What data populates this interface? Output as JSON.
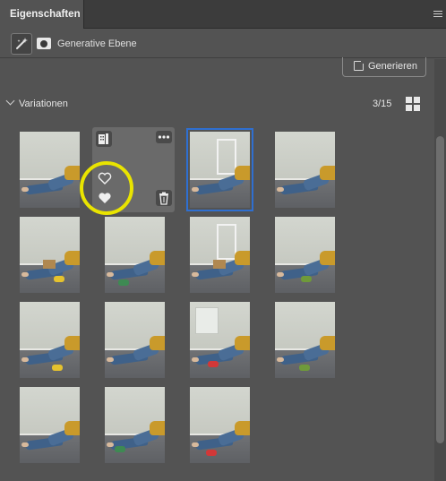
{
  "panel": {
    "tab_label": "Eigenschaften",
    "menu_icon": "hamburger-menu-icon"
  },
  "layer": {
    "label": "Generative Ebene",
    "type_icon": "generative-layer-icon",
    "mask_icon": "layer-mask-icon"
  },
  "generate_button": {
    "label": "Generieren",
    "icon": "generate-plus-icon"
  },
  "variations": {
    "label": "Variationen",
    "count": "3/15",
    "view_icon": "grid-view-icon",
    "thumbnails": [
      "Variation 1",
      "Variation 2",
      "Variation 3",
      "Variation 4",
      "Variation 5",
      "Variation 6",
      "Variation 7",
      "Variation 8",
      "Variation 9",
      "Variation 10",
      "Variation 11",
      "Variation 12",
      "Variation 13",
      "Variation 14",
      "Variation 15"
    ],
    "selected_index": 3,
    "hover_index": 2,
    "hover_tools": [
      "compare-icon",
      "more-options-icon",
      "like-icon",
      "dislike-icon",
      "delete-icon"
    ]
  },
  "colors": {
    "panel_bg": "#535353",
    "selection_outline": "#2f6fd0",
    "highlight_ring": "#e9e400"
  }
}
